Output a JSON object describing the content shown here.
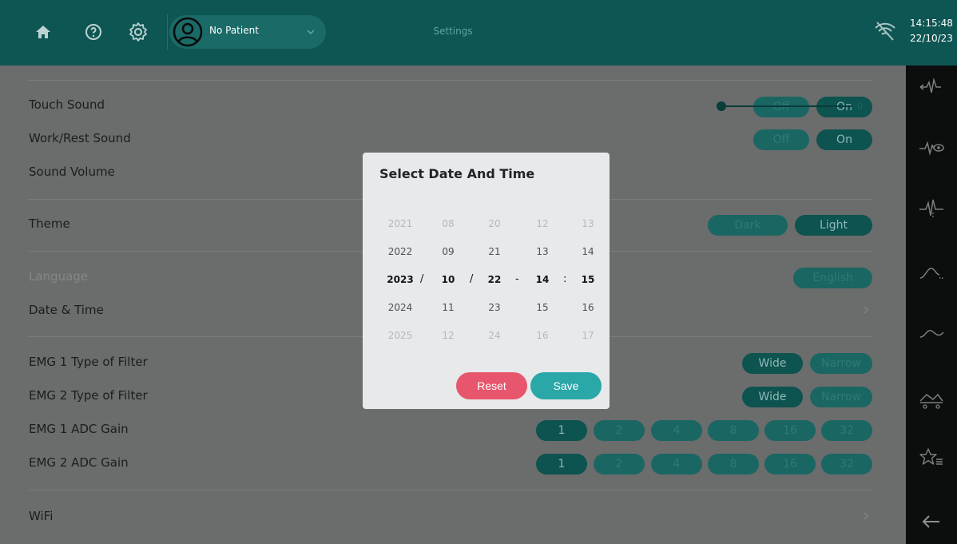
{
  "topbar": {
    "patient_label": "No Patient",
    "title": "Settings",
    "icons": [
      "home-icon",
      "help-icon",
      "gear-icon",
      "avatar-icon",
      "chevron-down-icon",
      "wifi-off-icon"
    ]
  },
  "clock": {
    "time": "14:15:48",
    "date": "22/10/23"
  },
  "rail": {
    "icons": [
      "emg-arrow-icon",
      "emg-eye-icon",
      "emg-signal-icon",
      "curve-flat-icon",
      "curve-wave-icon",
      "gait-icon",
      "star-list-icon",
      "back-arrow-icon"
    ]
  },
  "settings": {
    "touch_sound": {
      "label": "Touch Sound",
      "off": "Off",
      "on": "On"
    },
    "work_rest_sound": {
      "label": "Work/Rest Sound",
      "off": "Off",
      "on": "On"
    },
    "sound_volume": {
      "label": "Sound Volume",
      "value": "0"
    },
    "theme": {
      "label": "Theme",
      "dark": "Dark",
      "light": "Light"
    },
    "language": {
      "label": "Language",
      "value": "English"
    },
    "date_time": {
      "label": "Date & Time"
    },
    "emg1_filter": {
      "label": "EMG 1 Type of Filter",
      "wide": "Wide",
      "narrow": "Narrow"
    },
    "emg2_filter": {
      "label": "EMG 2 Type of Filter",
      "wide": "Wide",
      "narrow": "Narrow"
    },
    "emg1_gain": {
      "label": "EMG 1 ADC Gain",
      "options": [
        "1",
        "2",
        "4",
        "8",
        "16",
        "32"
      ]
    },
    "emg2_gain": {
      "label": "EMG 2 ADC Gain",
      "options": [
        "1",
        "2",
        "4",
        "8",
        "16",
        "32"
      ]
    },
    "wifi": {
      "label": "WiFi"
    }
  },
  "dialog": {
    "title": "Select Date And Time",
    "years": [
      "2021",
      "2022",
      "2023",
      "2024",
      "2025"
    ],
    "months": [
      "08",
      "09",
      "10",
      "11",
      "12"
    ],
    "days": [
      "20",
      "21",
      "22",
      "23",
      "24"
    ],
    "hours": [
      "12",
      "13",
      "14",
      "15",
      "16"
    ],
    "minutes": [
      "13",
      "14",
      "15",
      "16",
      "17"
    ],
    "separators": {
      "date": "/",
      "dash": "-",
      "time": ":"
    },
    "reset_label": "Reset",
    "save_label": "Save"
  },
  "colors": {
    "header": "#0e5654",
    "rail": "#0c0d0d",
    "overlay_bg": "#6b6c6c",
    "reset": "#e7566c",
    "save": "#2aa7a7",
    "dialog_bg": "#e7e9ea"
  }
}
